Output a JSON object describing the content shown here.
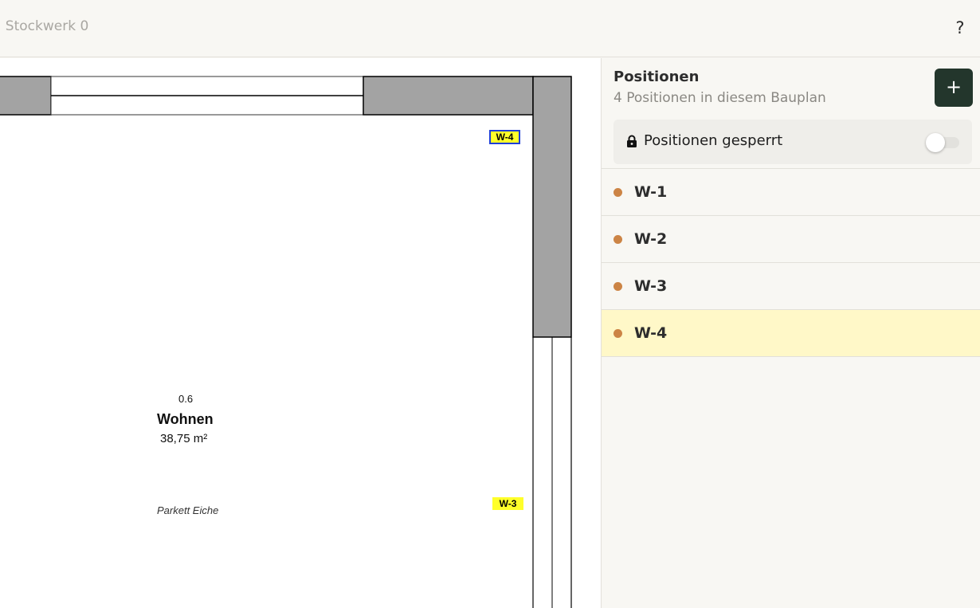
{
  "header": {
    "breadcrumb": "· Stockwerk 0",
    "help_label": "?"
  },
  "plan": {
    "room_number": "0.6",
    "room_name": "Wohnen",
    "room_area": "38,75 m²",
    "floor_material": "Parkett Eiche",
    "tags": [
      "W-4",
      "W-3"
    ]
  },
  "panel": {
    "title": "Positionen",
    "subtitle": "4 Positionen in diesem Bauplan",
    "add_label": "+",
    "lock_label": "Positionen gesperrt",
    "lock_enabled": false,
    "items": [
      {
        "label": "W-1",
        "selected": false
      },
      {
        "label": "W-2",
        "selected": false
      },
      {
        "label": "W-3",
        "selected": false
      },
      {
        "label": "W-4",
        "selected": true
      }
    ]
  },
  "colors": {
    "accent_button": "#23362c",
    "marker_dot": "#cc8445",
    "selected_row": "#fff8c8",
    "tag_fill": "#ffff2a",
    "tag_selected_border": "#1f3fd6",
    "wall_fill": "#a3a3a3"
  }
}
